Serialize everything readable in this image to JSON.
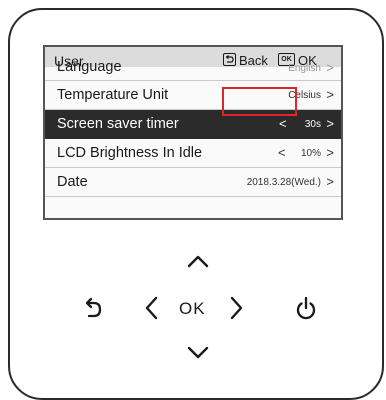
{
  "header": {
    "title": "User",
    "back_label": "Back",
    "ok_icon_text": "OK",
    "ok_label": "OK"
  },
  "settings": [
    {
      "label": "Language",
      "value": "English"
    },
    {
      "label": "Temperature Unit",
      "value": "Celsius"
    },
    {
      "label": "Screen saver timer",
      "value": "30s"
    },
    {
      "label": "LCD Brightness In Idle",
      "value": "10%"
    },
    {
      "label": "Date",
      "value": "2018.3.28(Wed.)"
    }
  ],
  "buttons": {
    "ok_label": "OK"
  },
  "icons": {
    "header_back": "back-return-icon",
    "header_ok": "ok-box-icon",
    "up": "chevron-up-icon",
    "down": "chevron-down-icon",
    "left": "chevron-left-icon",
    "right": "chevron-right-icon",
    "back": "return-arrow-icon",
    "power": "power-icon"
  },
  "colors": {
    "selected_row": "#2b2b2b",
    "highlight_box": "#e0242c"
  }
}
